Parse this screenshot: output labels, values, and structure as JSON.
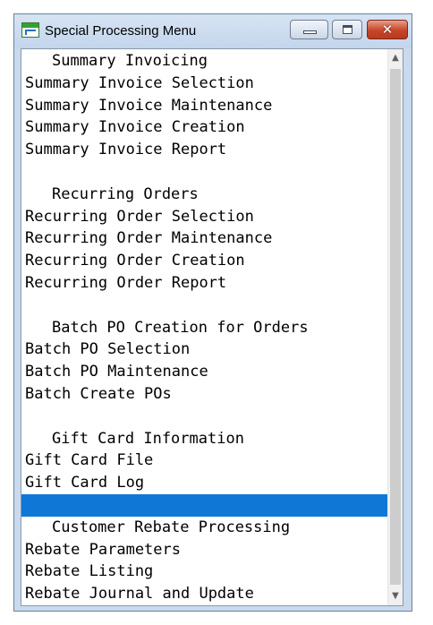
{
  "window": {
    "title": "Special Processing Menu",
    "icon": "app-window-icon",
    "buttons": {
      "minimize": "minimize-icon",
      "maximize": "maximize-icon",
      "close": "close-icon"
    }
  },
  "menu": [
    {
      "text": "Summary Invoicing",
      "type": "heading"
    },
    {
      "text": "Summary Invoice Selection",
      "type": "item"
    },
    {
      "text": "Summary Invoice Maintenance",
      "type": "item"
    },
    {
      "text": "Summary Invoice Creation",
      "type": "item"
    },
    {
      "text": "Summary Invoice Report",
      "type": "item"
    },
    {
      "text": "",
      "type": "blank"
    },
    {
      "text": "Recurring Orders",
      "type": "heading"
    },
    {
      "text": "Recurring Order Selection",
      "type": "item"
    },
    {
      "text": "Recurring Order Maintenance",
      "type": "item"
    },
    {
      "text": "Recurring Order Creation",
      "type": "item"
    },
    {
      "text": "Recurring Order Report",
      "type": "item"
    },
    {
      "text": "",
      "type": "blank"
    },
    {
      "text": "Batch PO Creation for Orders",
      "type": "heading"
    },
    {
      "text": "Batch PO Selection",
      "type": "item"
    },
    {
      "text": "Batch PO Maintenance",
      "type": "item"
    },
    {
      "text": "Batch Create POs",
      "type": "item"
    },
    {
      "text": "",
      "type": "blank"
    },
    {
      "text": "Gift Card Information",
      "type": "heading"
    },
    {
      "text": "Gift Card File",
      "type": "item"
    },
    {
      "text": "Gift Card Log",
      "type": "item"
    },
    {
      "text": "",
      "type": "selected"
    },
    {
      "text": "Customer Rebate Processing",
      "type": "heading"
    },
    {
      "text": "Rebate Parameters",
      "type": "item"
    },
    {
      "text": "Rebate Listing",
      "type": "item"
    },
    {
      "text": "Rebate Journal and Update",
      "type": "item"
    }
  ],
  "colors": {
    "selection": "#0f78d7",
    "frame": "#c9daee",
    "close_button": "#c7452a"
  },
  "scrollbar": {
    "up_icon": "scroll-up-arrow-icon",
    "down_icon": "scroll-down-arrow-icon"
  }
}
